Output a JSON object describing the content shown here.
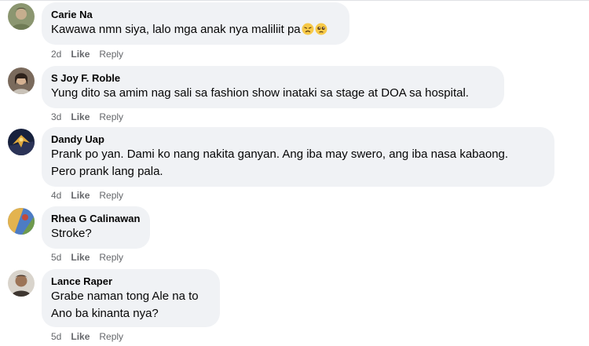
{
  "comments": [
    {
      "author": "Carie Na",
      "lines": [
        "Kawawa nmn siya, lalo mga anak nya maliliit pa"
      ],
      "emojis": [
        "sad-face",
        "pleading-face"
      ],
      "time": "2d",
      "like": "Like",
      "reply": "Reply",
      "avatar_colors": [
        "#7d8a5a",
        "#b9a98a"
      ]
    },
    {
      "author": "S Joy F. Roble",
      "lines": [
        "Yung dito sa amim nag sali sa fashion show inataki sa stage at DOA sa hospital."
      ],
      "time": "3d",
      "like": "Like",
      "reply": "Reply",
      "avatar_colors": [
        "#5c4a3e",
        "#caa98c"
      ]
    },
    {
      "author": "Dandy Uap",
      "lines": [
        "Prank po yan. Dami ko nang nakita ganyan. Ang iba may swero, ang iba nasa kabaong.",
        "Pero prank lang pala."
      ],
      "time": "4d",
      "like": "Like",
      "reply": "Reply",
      "avatar_colors": [
        "#1e2a4a",
        "#d9a441"
      ]
    },
    {
      "author": "Rhea G Calinawan",
      "lines": [
        "Stroke?"
      ],
      "time": "5d",
      "like": "Like",
      "reply": "Reply",
      "avatar_colors": [
        "#3c6db5",
        "#e5b24c"
      ]
    },
    {
      "author": "Lance Raper",
      "lines": [
        "Grabe naman tong Ale na to",
        "Ano ba kinanta nya?"
      ],
      "time": "5d",
      "like": "Like",
      "reply": "Reply",
      "avatar_colors": [
        "#4b4038",
        "#a67c5b"
      ]
    }
  ]
}
